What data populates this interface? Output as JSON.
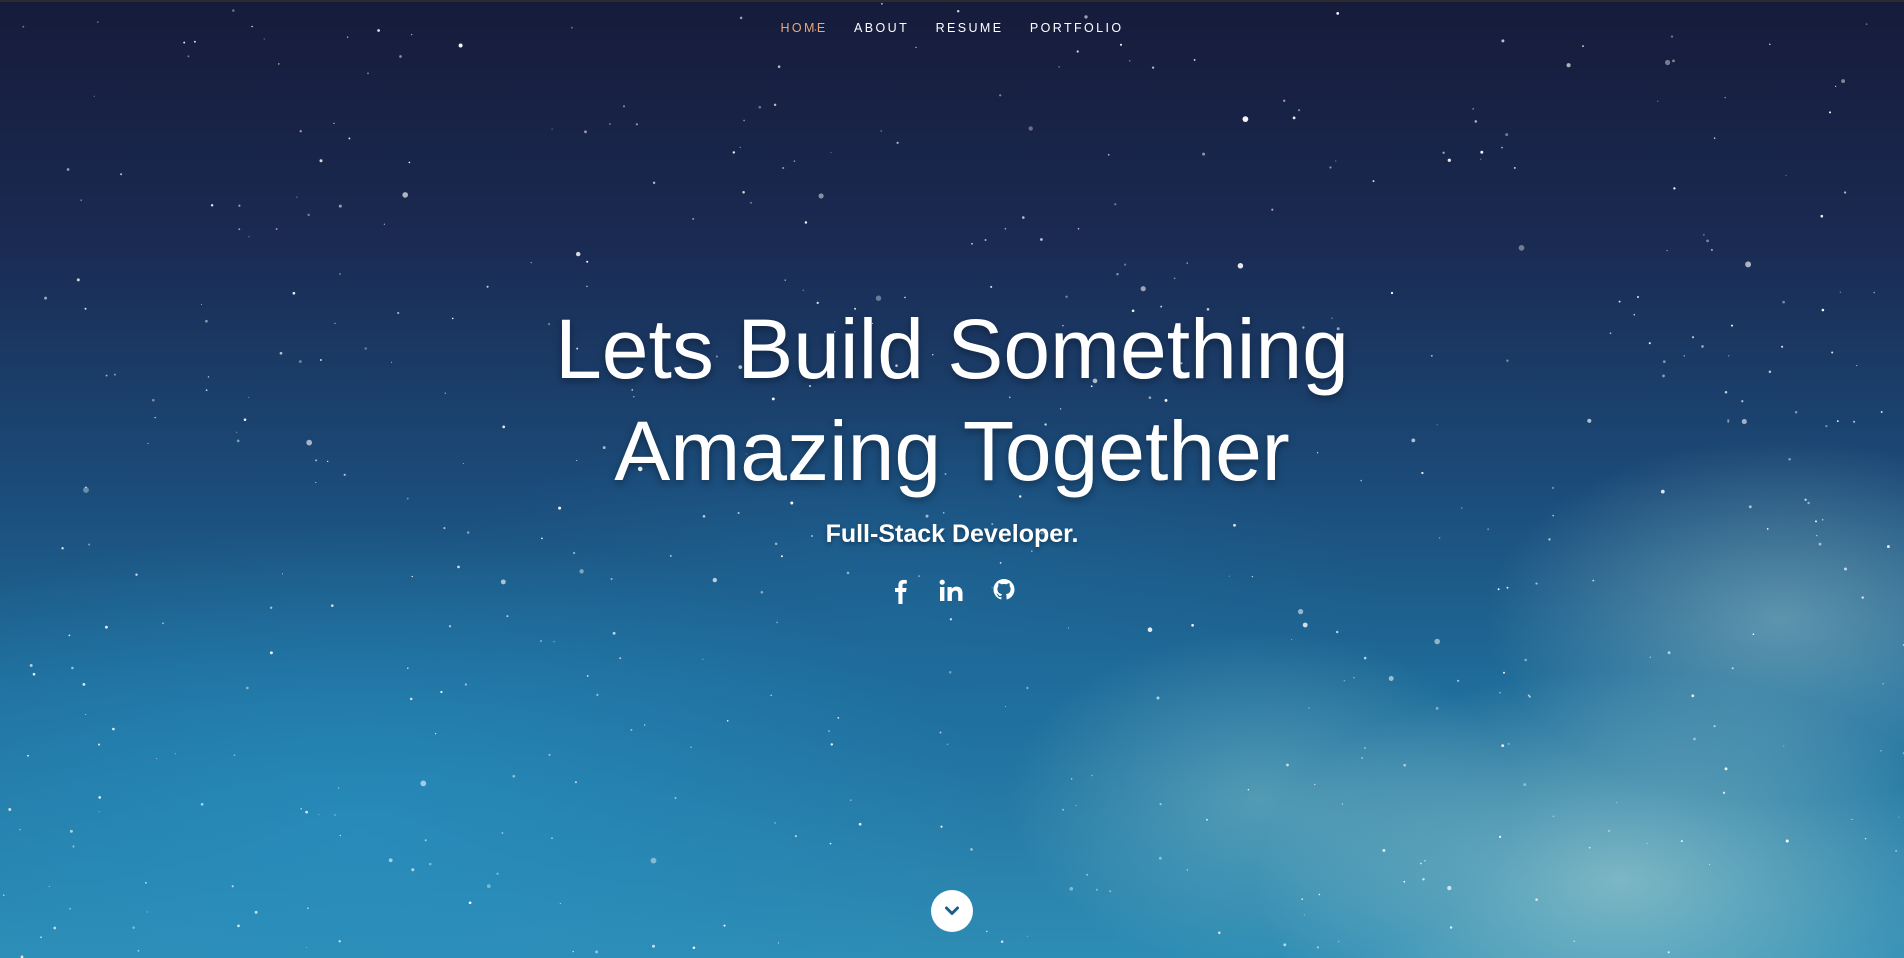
{
  "nav": {
    "items": [
      {
        "label": "HOME",
        "active": true
      },
      {
        "label": "ABOUT",
        "active": false
      },
      {
        "label": "RESUME",
        "active": false
      },
      {
        "label": "PORTFOLIO",
        "active": false
      }
    ],
    "active_color": "#e8a77c"
  },
  "hero": {
    "headline_line1": "Lets Build Something",
    "headline_line2": "Amazing Together",
    "subtitle": "Full-Stack Developer."
  },
  "social": {
    "icons": [
      "facebook-icon",
      "linkedin-icon",
      "github-icon"
    ]
  },
  "scroll_down": {
    "icon": "chevron-down-icon"
  }
}
